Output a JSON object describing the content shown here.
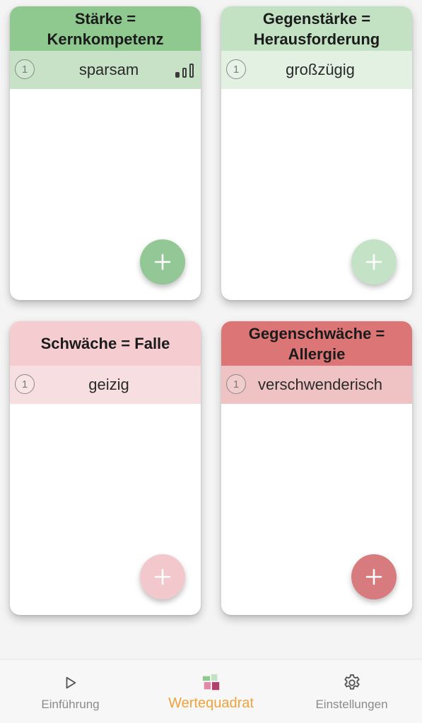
{
  "quadrants": {
    "top_left": {
      "title_line1": "Stärke =",
      "title_line2": "Kernkompetenz",
      "rank": "1",
      "value": "sparsam",
      "indicator_icon": "signal-strength-icon",
      "color": "#8fc98f"
    },
    "top_right": {
      "title_line1": "Gegenstärke =",
      "title_line2": "Herausforderung",
      "rank": "1",
      "value": "großzügig",
      "color": "#c3e2c3"
    },
    "bottom_left": {
      "title_line1": "Schwäche = Falle",
      "rank": "1",
      "value": "geizig",
      "color": "#f5ccd0"
    },
    "bottom_right": {
      "title_line1": "Gegenschwäche =",
      "title_line2": "Allergie",
      "rank": "1",
      "value": "verschwenderisch",
      "color": "#dc7676"
    }
  },
  "add_button_icon": "plus-icon",
  "tabbar": {
    "tabs": [
      {
        "label": "Einführung",
        "icon": "play-icon",
        "active": false
      },
      {
        "label": "Wertequadrat",
        "icon": "wertequadrat-icon",
        "active": true
      },
      {
        "label": "Einstellungen",
        "icon": "gear-icon",
        "active": false
      }
    ],
    "active_color": "#f0a23c"
  }
}
